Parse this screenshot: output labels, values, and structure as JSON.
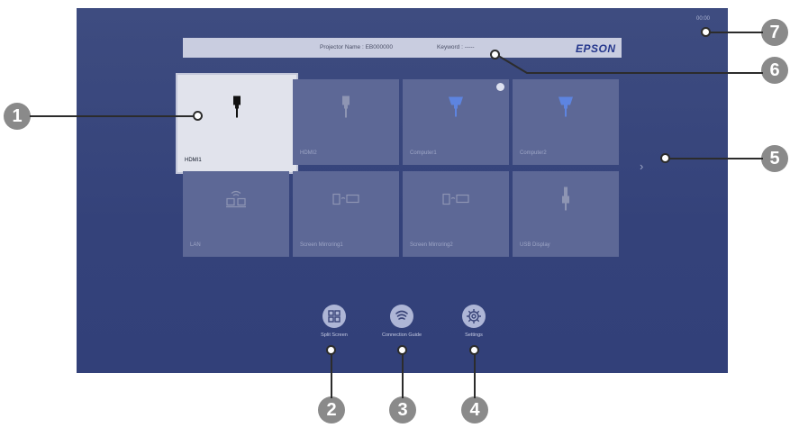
{
  "home": {
    "projector_name": "Projector Name : EB000000",
    "keyword": "Keyword : -----",
    "brand": "EPSON",
    "time": "00:00"
  },
  "sources": [
    {
      "label": "HDMI1",
      "icon": "hdmi-icon",
      "selected": true
    },
    {
      "label": "HDMI2",
      "icon": "hdmi-icon"
    },
    {
      "label": "Computer1",
      "icon": "vga-icon",
      "checked": true
    },
    {
      "label": "Computer2",
      "icon": "vga-icon"
    },
    {
      "label": "LAN",
      "icon": "lan-icon"
    },
    {
      "label": "Screen Mirroring1",
      "icon": "screen-mirroring-icon"
    },
    {
      "label": "Screen Mirroring2",
      "icon": "screen-mirroring-icon"
    },
    {
      "label": "USB Display",
      "icon": "usb-icon"
    }
  ],
  "menu": {
    "split_screen": "Split Screen",
    "connection_guide": "Connection Guide",
    "settings": "Settings"
  },
  "callouts": [
    "1",
    "2",
    "3",
    "4",
    "5",
    "6",
    "7"
  ]
}
